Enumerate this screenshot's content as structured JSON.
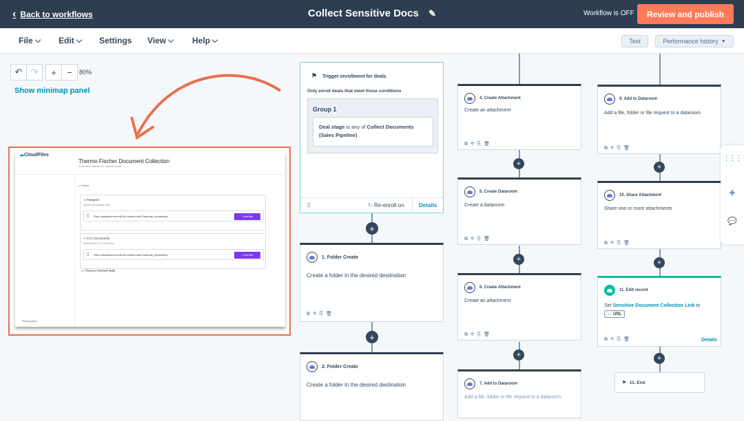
{
  "topbar": {
    "back_label": "Back to workflows",
    "title": "Collect Sensitive Docs",
    "status": "Workflow is OFF",
    "publish_label": "Review and publish"
  },
  "menu": {
    "file": "File",
    "edit": "Edit",
    "settings": "Settings",
    "view": "View",
    "help": "Help",
    "test": "Test",
    "performance": "Performance history"
  },
  "canvas": {
    "zoom": "80%",
    "minimap": "Show minimap panel"
  },
  "preview": {
    "logo": "CloudFiles",
    "title": "Thermo Fischer Document Collection",
    "subtitle": "Document Collection for Thermo Fischer",
    "home": "Home",
    "sections": [
      {
        "title": "Passport",
        "sub": "Upload your passport here.",
        "drop": "Files uploaded here will be shared with Shounak_chowdhury",
        "add": "+ Add files"
      },
      {
        "title": "KYC Documents",
        "sub": "Upload all the KYC Docs here.",
        "drop": "Files uploaded here will be shared with Shounak_chowdhury",
        "add": "+ Add files"
      }
    ],
    "folder": "Thermo FischerFolder",
    "privacy": "Privacy policy"
  },
  "trigger": {
    "title": "Trigger enrollment for deals",
    "condition": "Only enroll deals that meet these conditions",
    "group": "Group 1",
    "filter_prop1": "Deal stage",
    "filter_op": " is any of ",
    "filter_val": "Collect Documents (Sales Pipeline)",
    "reenroll": "Re-enroll on",
    "details": "Details"
  },
  "steps": [
    {
      "title": "1. Folder Create",
      "desc": "Create a folder in the desired destination"
    },
    {
      "title": "2. Folder Create",
      "desc": "Create a folder in the desired destination"
    },
    {
      "title": "4. Create Attachment",
      "desc": "Create an attachment"
    },
    {
      "title": "5. Create Dataroom",
      "desc": "Create a dataroom"
    },
    {
      "title": "6. Create Attachment",
      "desc": "Create an attachment"
    },
    {
      "title": "7. Add to Dataroom",
      "desc": "Add a file, folder or file request to a dataroom"
    },
    {
      "title": "9. Add to Dataroom",
      "desc": "Add a file, folder or file request to a dataroom"
    },
    {
      "title": "10. Share Attachment",
      "desc": "Share one or more attachments"
    }
  ],
  "edit_record": {
    "title": "11. Edit record",
    "set": "Set ",
    "prop": "Sensitive Document Collection Link",
    "to": " to",
    "token": "URL",
    "details": "Details"
  },
  "end": {
    "title": "11. End"
  },
  "tools_glyphs": "⧉✥⎘🗑",
  "colors": {
    "topbar": "#2d3e50",
    "accent": "#ff7a59",
    "link": "#0091ae",
    "preview_border": "#e8704e"
  }
}
